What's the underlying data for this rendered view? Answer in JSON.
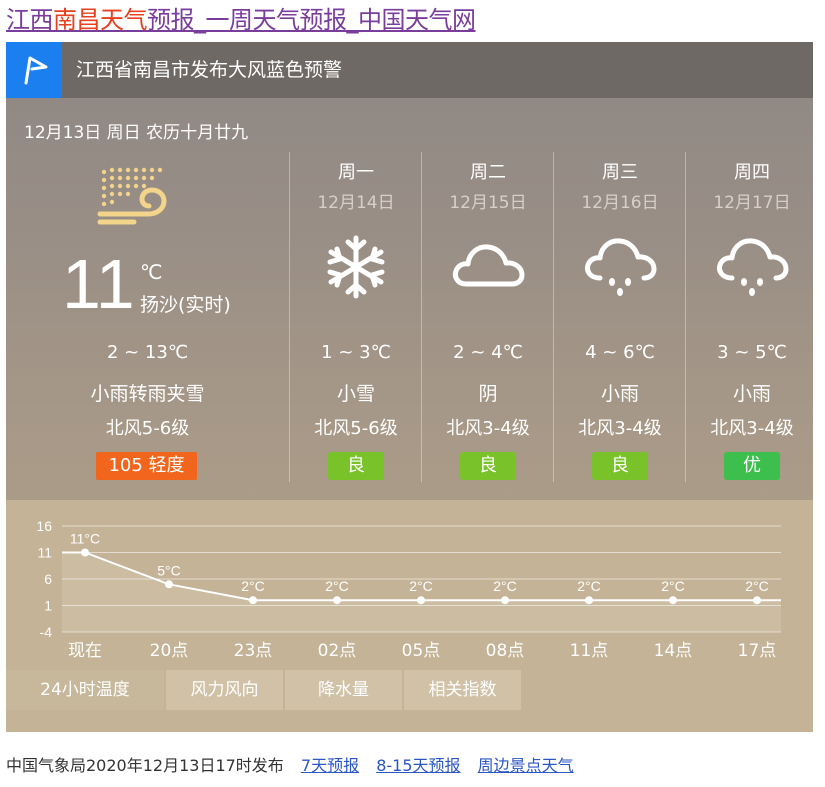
{
  "title": {
    "part1": "江西",
    "part2": "南昌天气",
    "part3": "预报_一周天气预报_中国天气网"
  },
  "alert": {
    "icon": "flag-icon",
    "text": "江西省南昌市发布大风蓝色预警"
  },
  "date_line": "12月13日 周日 农历十月廿九",
  "today": {
    "icon": "sandstorm-icon",
    "temp": "11",
    "unit": "℃",
    "cond_now": "扬沙(实时)",
    "range": "2 ~ 13℃",
    "weather": "小雨转雨夹雪",
    "wind": "北风5-6级",
    "aqi": "105  轻度",
    "aqi_color": "#f2651d"
  },
  "days": [
    {
      "name": "周一",
      "date": "12月14日",
      "icon": "snow-icon",
      "range": "1 ~ 3℃",
      "weather": "小雪",
      "wind": "北风5-6级",
      "aqi": "良",
      "aqi_color": "#79c22a"
    },
    {
      "name": "周二",
      "date": "12月15日",
      "icon": "cloudy-icon",
      "range": "2 ~ 4℃",
      "weather": "阴",
      "wind": "北风3-4级",
      "aqi": "良",
      "aqi_color": "#79c22a"
    },
    {
      "name": "周三",
      "date": "12月16日",
      "icon": "rain-icon",
      "range": "4 ~ 6℃",
      "weather": "小雨",
      "wind": "北风3-4级",
      "aqi": "良",
      "aqi_color": "#79c22a"
    },
    {
      "name": "周四",
      "date": "12月17日",
      "icon": "rain-icon",
      "range": "3 ~ 5℃",
      "weather": "小雨",
      "wind": "北风3-4级",
      "aqi": "优",
      "aqi_color": "#3cbf4c"
    }
  ],
  "tabs": [
    {
      "label": "24小时温度",
      "active": true
    },
    {
      "label": "风力风向",
      "active": false
    },
    {
      "label": "降水量",
      "active": false
    },
    {
      "label": "相关指数",
      "active": false
    }
  ],
  "chart_data": {
    "type": "line",
    "categories": [
      "现在",
      "20点",
      "23点",
      "02点",
      "05点",
      "08点",
      "11点",
      "14点",
      "17点"
    ],
    "values": [
      11,
      5,
      2,
      2,
      2,
      2,
      2,
      2,
      2
    ],
    "value_labels": [
      "11°C",
      "5°C",
      "2°C",
      "2°C",
      "2°C",
      "2°C",
      "2°C",
      "2°C",
      "2°C"
    ],
    "yticks": [
      "16",
      "11",
      "6",
      "1",
      "-4"
    ],
    "ylim": [
      -4,
      16
    ],
    "grid": true
  },
  "footer": {
    "publish": "中国气象局2020年12月13日17时发布",
    "links": [
      "7天预报",
      "8-15天预报",
      "周边景点天气"
    ]
  }
}
